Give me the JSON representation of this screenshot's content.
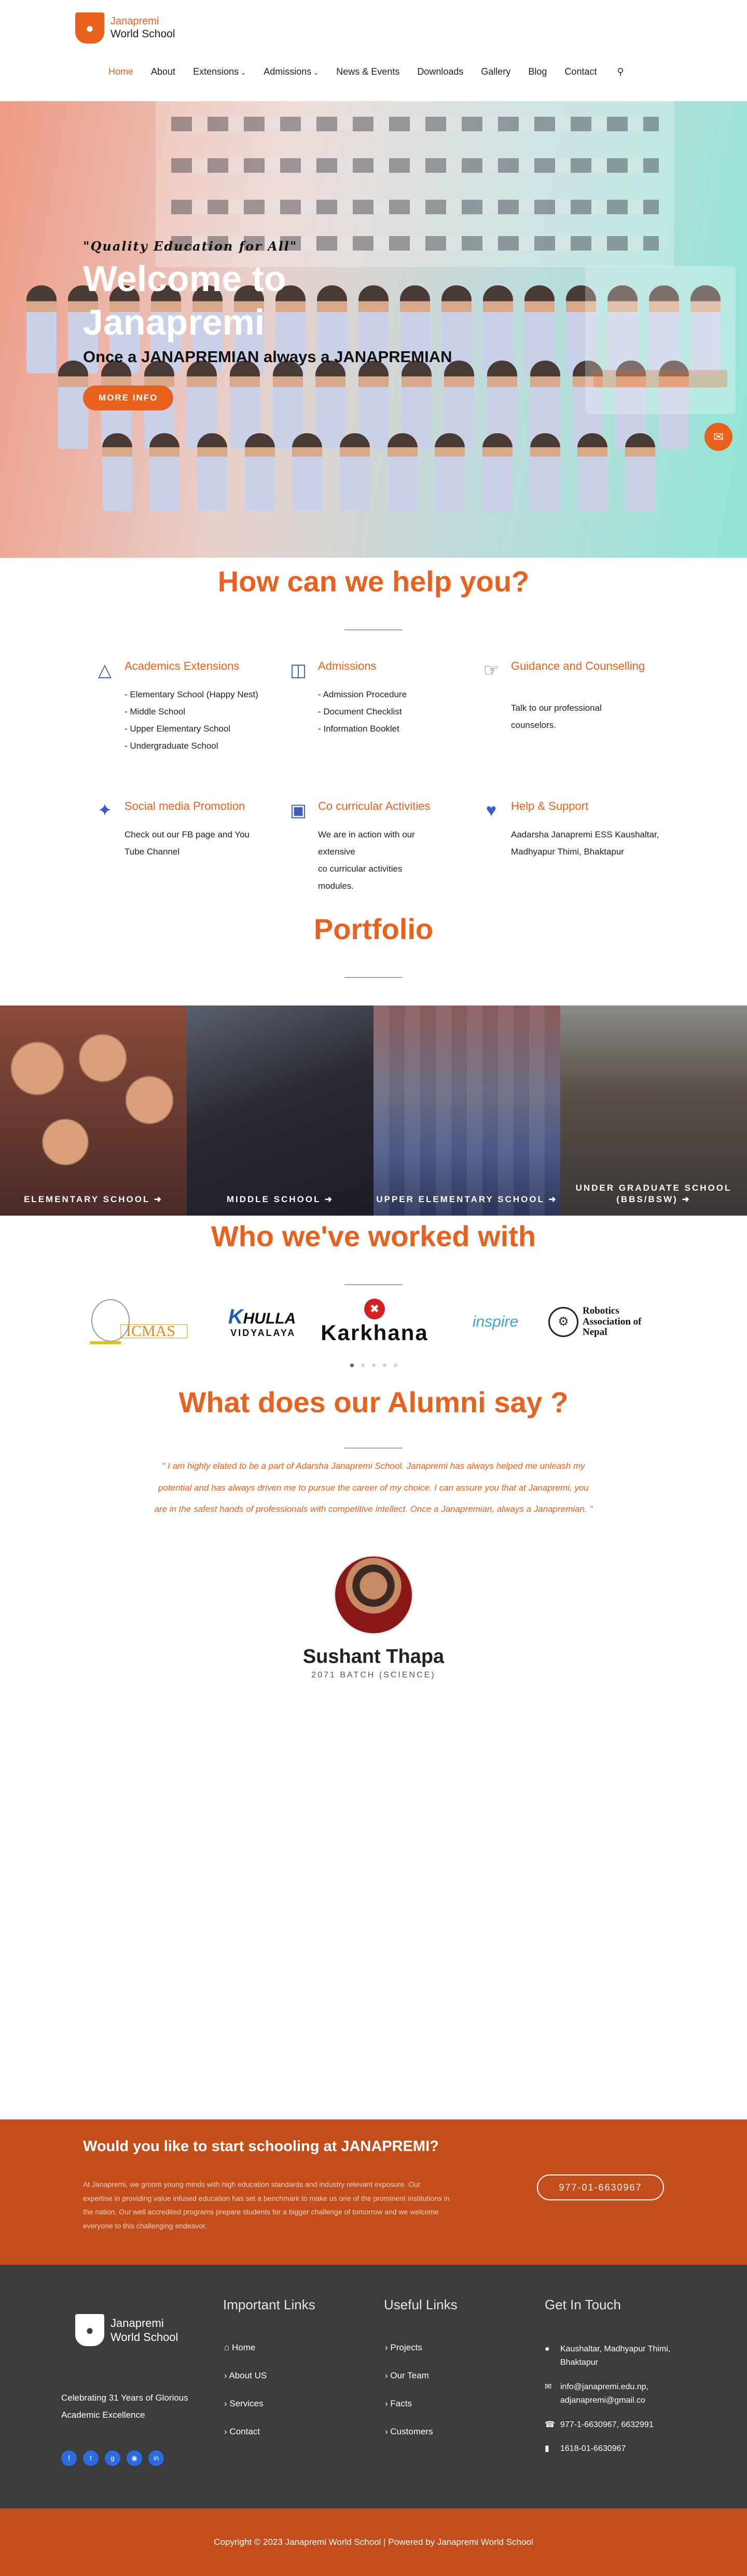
{
  "header": {
    "logo_line1": "Janapremi",
    "logo_line2": "World School",
    "nav": [
      {
        "label": "Home"
      },
      {
        "label": "About"
      },
      {
        "label": "Extensions"
      },
      {
        "label": "Admissions"
      },
      {
        "label": "News & Events"
      },
      {
        "label": "Downloads"
      },
      {
        "label": "Gallery"
      },
      {
        "label": "Blog"
      },
      {
        "label": "Contact"
      }
    ]
  },
  "hero": {
    "quote": "\"Quality Education for All\"",
    "title": "Welcome to Janapremi",
    "subtitle": "Once a JANAPREMIAN always a JANAPREMIAN",
    "button": "MORE INFO"
  },
  "help": {
    "title": "How can we help you?",
    "services": [
      {
        "title": "Academics Extensions",
        "lines": [
          "- Elementary School (Happy Nest)",
          "- Middle School",
          "- Upper Elementary School",
          "- Undergraduate School"
        ]
      },
      {
        "title": "Admissions",
        "lines": [
          "- Admission Procedure",
          "- Document Checklist",
          "- Information Booklet"
        ]
      },
      {
        "title": "Guidance and Counselling",
        "lines": [
          "Talk to our professional counselors."
        ]
      },
      {
        "title": "Social media Promotion",
        "lines": [
          "Check out our FB page and You Tube Channel"
        ]
      },
      {
        "title": "Co curricular Activities",
        "lines": [
          "We are in action with our extensive",
          "co curricular activities modules."
        ]
      },
      {
        "title": "Help & Support",
        "lines": [
          "Aadarsha  Janapremi ESS Kaushaltar, Madhyapur Thimi, Bhaktapur"
        ]
      }
    ]
  },
  "portfolio": {
    "title": "Portfolio",
    "items": [
      {
        "label": "ELEMENTARY SCHOOL"
      },
      {
        "label": "MIDDLE SCHOOL"
      },
      {
        "label": "UPPER ELEMENTARY SCHOOL"
      },
      {
        "label": "UNDER GRADUATE SCHOOL (BBS/BSW)"
      }
    ]
  },
  "partners": {
    "title": "Who we've worked with",
    "logos": [
      {
        "name": "ICMAS",
        "color": "#e08a1a"
      },
      {
        "name": "KHULLA VIDYALAYA",
        "color": "#1f5fbf"
      },
      {
        "name": "Karkhana",
        "color": "#111111"
      },
      {
        "name": "inspire",
        "color": "#3aa7c7"
      },
      {
        "name": "Robotics Association of Nepal",
        "color": "#111111"
      }
    ]
  },
  "alumni": {
    "title": "What does our Alumni say ?",
    "quote": "\" I am highly elated to be a part of Adarsha Janapremi School. Janapremi has always helped me unleash my potential and has always driven me to pursue the career of my choice. I can assure you that at Janapremi, you are in the safest hands of professionals with competitive intellect. Once a Janapremian, always a Janapremian. \"",
    "name": "Sushant Thapa",
    "batch": "2071 BATCH (SCIENCE)"
  },
  "cta": {
    "title": "Would you like to start schooling at JANAPREMI?",
    "body": "At Janapremi, we groom young minds with high education standards and industry relevant exposure. Our expertise in providing value infused education has set a benchmark to make us one of the prominent institutions in the nation. Our well accredited programs prepare students for a bigger challenge of tomorrow and we welcome everyone to this challenging endeavor.",
    "phone": "977-01-6630967"
  },
  "footer": {
    "logo_line1": "Janapremi",
    "logo_line2": "World School",
    "tagline": "Celebrating 31 Years of Glorious Academic Excellence",
    "important_title": "Important Links",
    "important": [
      "Home",
      "About US",
      "Services",
      "Contact"
    ],
    "useful_title": "Useful Links",
    "useful": [
      "Projects",
      "Our Team",
      "Facts",
      "Customers"
    ],
    "contact_title": "Get In Touch",
    "address": "Kaushaltar, Madhyapur Thimi, Bhaktapur",
    "email": "info@janapremi.edu.np, adjanapremi@gmail.co",
    "phone": "977-1-6630967, 6632991",
    "fax": "1618-01-6630967",
    "copyright": "Copyright © 2023 Janapremi World School | Powered by Janapremi World School"
  },
  "colors": {
    "accent": "#e8611e",
    "dark_accent": "#c44e1b",
    "footer_bg": "#3c3c3c",
    "icon_blue": "#3b5fc0"
  }
}
